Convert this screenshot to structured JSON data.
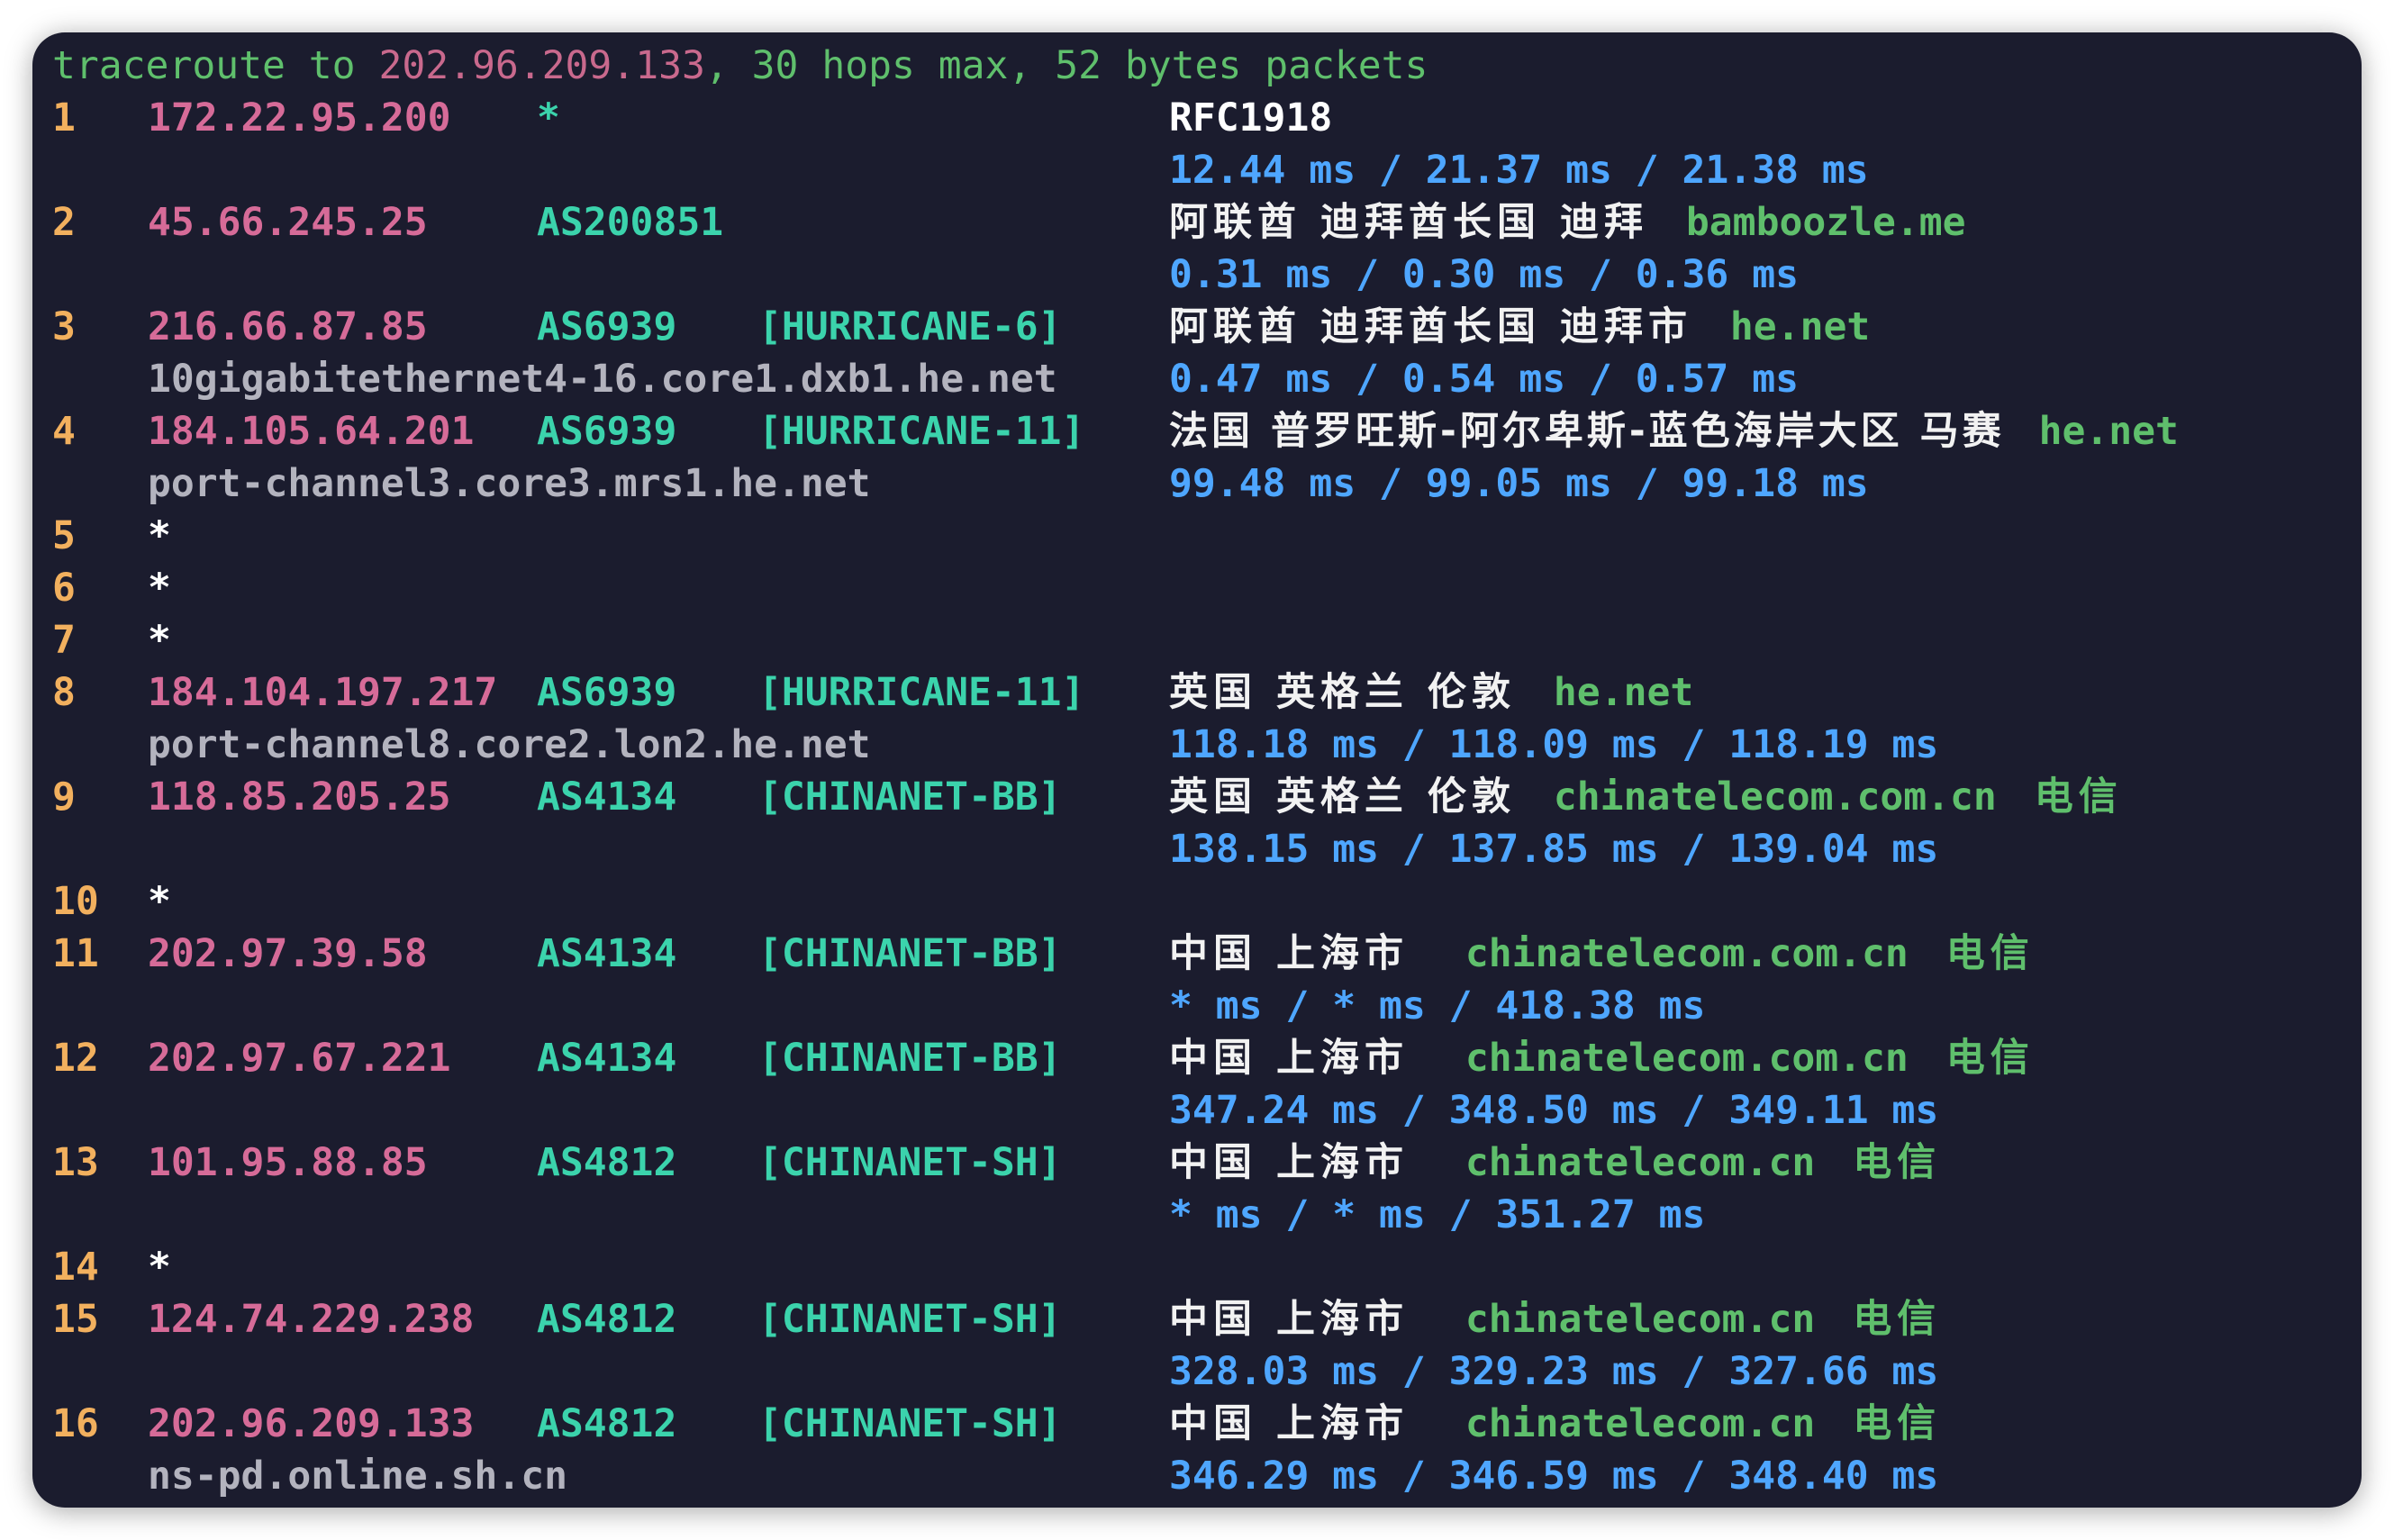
{
  "header": {
    "prefix": "traceroute to ",
    "target": "202.96.209.133",
    "sep1": ", ",
    "max_hops": "30",
    "hops_text": " hops max, ",
    "size": "52",
    "size_text": " bytes packets"
  },
  "hops": [
    {
      "num": "1",
      "ip": "172.22.95.200",
      "star_asn": "*",
      "location": "RFC1918",
      "rtt": "12.44 ms / 21.37 ms / 21.38 ms"
    },
    {
      "num": "2",
      "ip": "45.66.245.25",
      "asn": "AS200851",
      "location": "阿联酋 迪拜酋长国 迪拜",
      "domain": "bamboozle.me",
      "rtt": "0.31 ms / 0.30 ms / 0.36 ms"
    },
    {
      "num": "3",
      "ip": "216.66.87.85",
      "asn": "AS6939",
      "tag": "[HURRICANE-6]",
      "location": "阿联酋 迪拜酋长国 迪拜市",
      "domain": "he.net",
      "rdns": "10gigabitethernet4-16.core1.dxb1.he.net",
      "rtt": "0.47 ms / 0.54 ms / 0.57 ms"
    },
    {
      "num": "4",
      "ip": "184.105.64.201",
      "asn": "AS6939",
      "tag": "[HURRICANE-11]",
      "location": "法国 普罗旺斯-阿尔卑斯-蓝色海岸大区 马赛",
      "domain": "he.net",
      "rdns": "port-channel3.core3.mrs1.he.net",
      "rtt": "99.48 ms / 99.05 ms / 99.18 ms"
    },
    {
      "num": "5",
      "star": "*"
    },
    {
      "num": "6",
      "star": "*"
    },
    {
      "num": "7",
      "star": "*"
    },
    {
      "num": "8",
      "ip": "184.104.197.217",
      "asn": "AS6939",
      "tag": "[HURRICANE-11]",
      "location": "英国 英格兰 伦敦",
      "domain": "he.net",
      "rdns": "port-channel8.core2.lon2.he.net",
      "rtt": "118.18 ms / 118.09 ms / 118.19 ms"
    },
    {
      "num": "9",
      "ip": "118.85.205.25",
      "asn": "AS4134",
      "tag": "[CHINANET-BB]",
      "location": "英国 英格兰 伦敦",
      "domain": "chinatelecom.com.cn",
      "isp": "电信",
      "rtt": "138.15 ms / 137.85 ms / 139.04 ms"
    },
    {
      "num": "10",
      "star": "*"
    },
    {
      "num": "11",
      "ip": "202.97.39.58",
      "asn": "AS4134",
      "tag": "[CHINANET-BB]",
      "location": "中国 上海市",
      "domain": "chinatelecom.com.cn",
      "isp": "电信",
      "rtt": "* ms / * ms / 418.38 ms"
    },
    {
      "num": "12",
      "ip": "202.97.67.221",
      "asn": "AS4134",
      "tag": "[CHINANET-BB]",
      "location": "中国 上海市",
      "domain": "chinatelecom.com.cn",
      "isp": "电信",
      "rtt": "347.24 ms / 348.50 ms / 349.11 ms"
    },
    {
      "num": "13",
      "ip": "101.95.88.85",
      "asn": "AS4812",
      "tag": "[CHINANET-SH]",
      "location": "中国 上海市",
      "domain": "chinatelecom.cn",
      "isp": "电信",
      "rtt": "* ms / * ms / 351.27 ms"
    },
    {
      "num": "14",
      "star": "*"
    },
    {
      "num": "15",
      "ip": "124.74.229.238",
      "asn": "AS4812",
      "tag": "[CHINANET-SH]",
      "location": "中国 上海市",
      "domain": "chinatelecom.cn",
      "isp": "电信",
      "rtt": "328.03 ms / 329.23 ms / 327.66 ms"
    },
    {
      "num": "16",
      "ip": "202.96.209.133",
      "asn": "AS4812",
      "tag": "[CHINANET-SH]",
      "location": "中国 上海市",
      "domain": "chinatelecom.cn",
      "isp": "电信",
      "rdns": "ns-pd.online.sh.cn",
      "rtt": "346.29 ms / 346.59 ms / 348.40 ms"
    }
  ]
}
